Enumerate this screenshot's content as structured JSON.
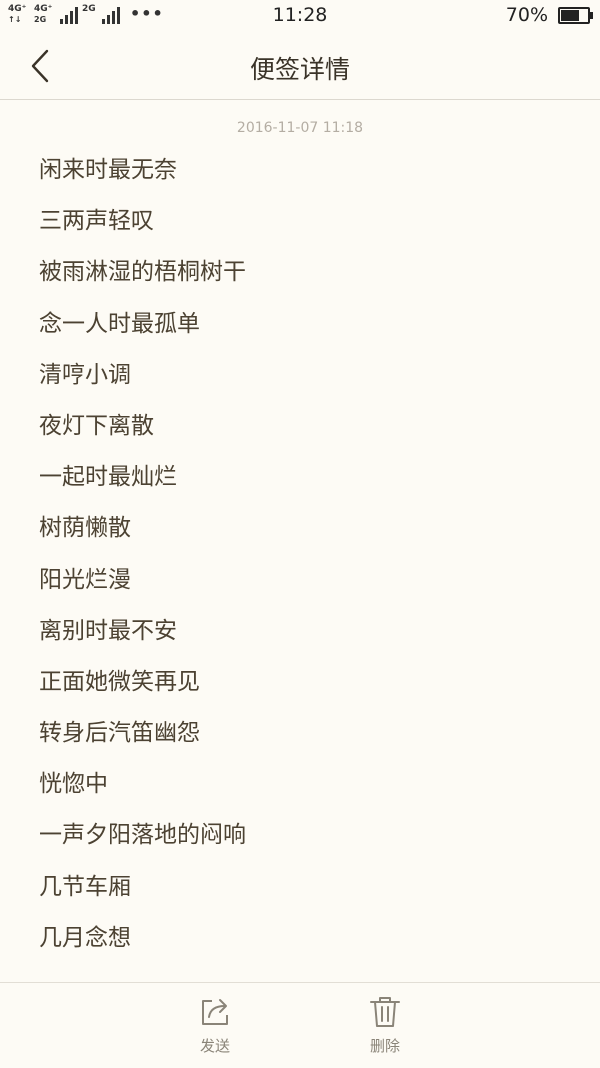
{
  "status_bar": {
    "net1_top": "4G⁺",
    "net1_bottom": "↑↓",
    "net2_top": "4G⁺",
    "net2_bottom": "2G",
    "net3_top": "2G",
    "more": "•••",
    "time": "11:28",
    "battery_text": "70%",
    "battery_level": 0.7
  },
  "nav": {
    "title": "便签详情",
    "back_icon": "chevron-left-icon"
  },
  "note": {
    "timestamp": "2016-11-07 11:18",
    "lines": [
      "闲来时最无奈",
      "三两声轻叹",
      "被雨淋湿的梧桐树干",
      "念一人时最孤单",
      "清哼小调",
      "夜灯下离散",
      "一起时最灿烂",
      "树荫懒散",
      "阳光烂漫",
      "离别时最不安",
      "正面她微笑再见",
      "转身后汽笛幽怨",
      "恍惚中",
      "一声夕阳落地的闷响",
      "几节车厢",
      "几月念想"
    ]
  },
  "actions": {
    "send_label": "发送",
    "send_icon": "share-icon",
    "delete_label": "删除",
    "delete_icon": "trash-icon"
  },
  "colors": {
    "background": "#fdfbf5",
    "text": "#4c4232",
    "timestamp": "#b4ada3",
    "divider": "#dcd8cf"
  }
}
